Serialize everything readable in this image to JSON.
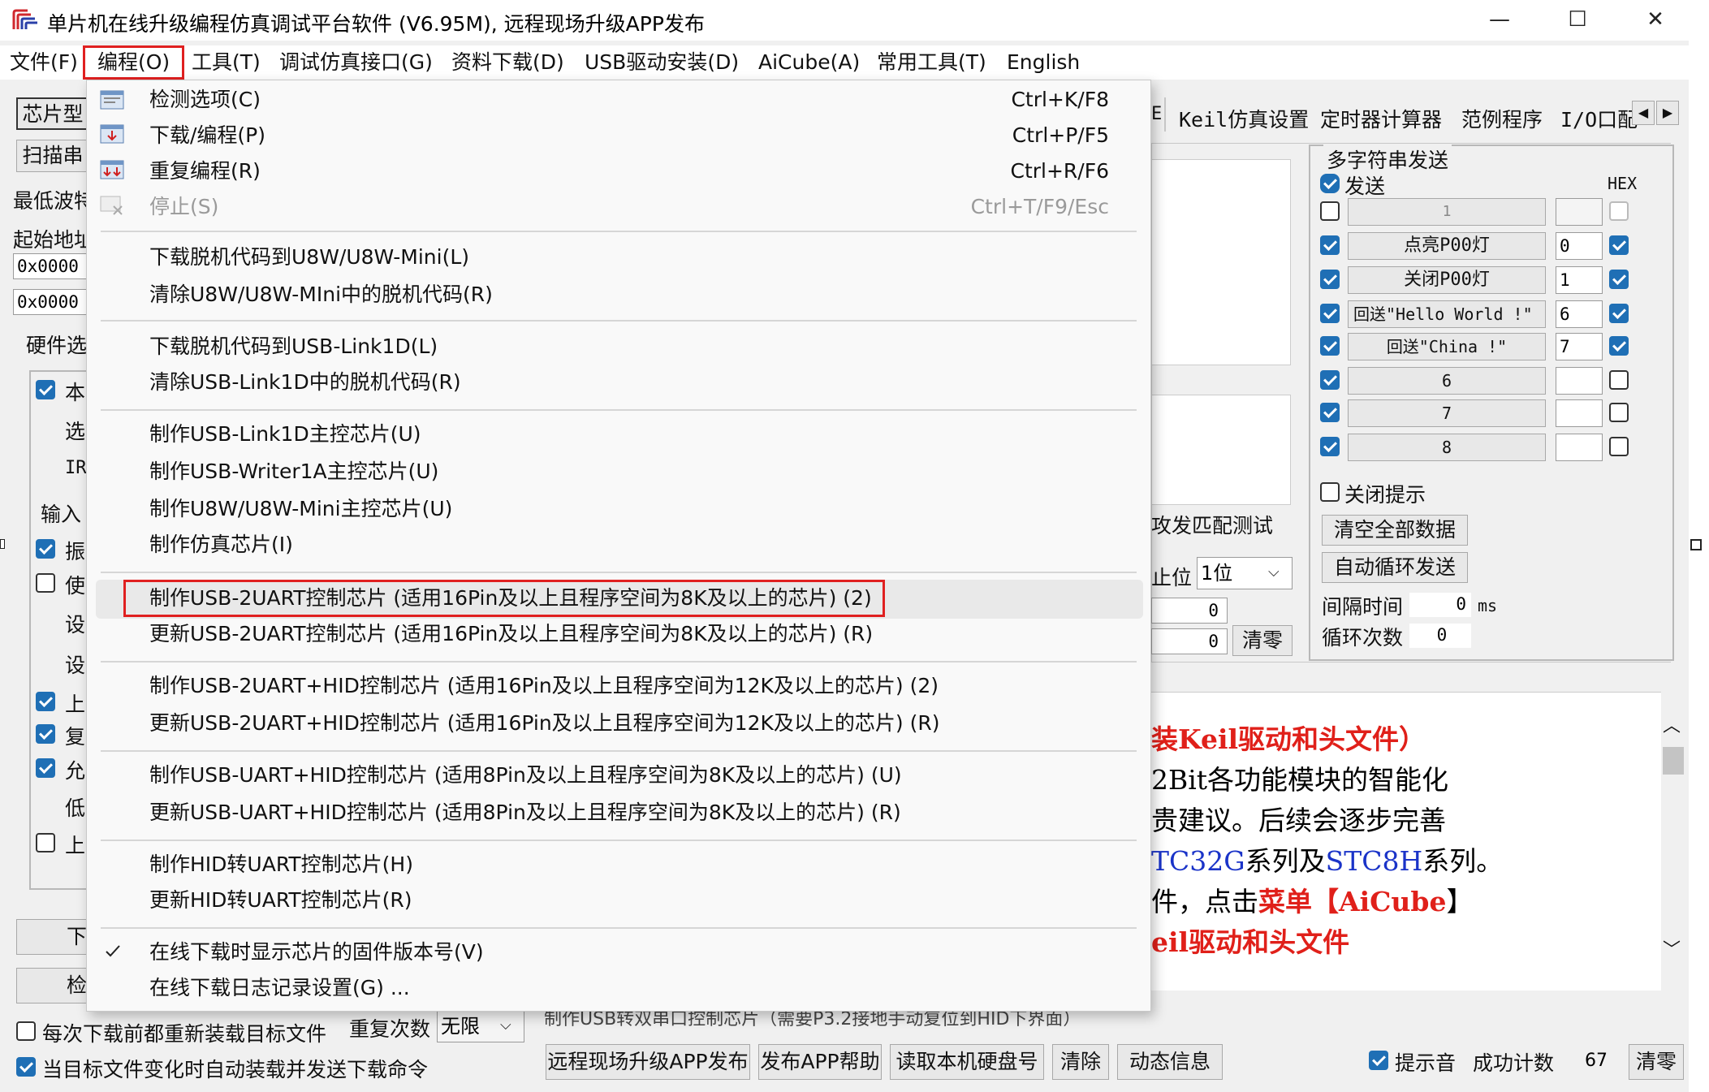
{
  "window": {
    "title": "单片机在线升级编程仿真调试平台软件 (V6.95M), 远程现场升级APP发布",
    "minimize": "—",
    "maximize": "☐",
    "close": "✕"
  },
  "menubar": [
    "文件(F)",
    "编程(O)",
    "工具(T)",
    "调试仿真接口(G)",
    "资料下载(D)",
    "USB驱动安装(D)",
    "AiCube(A)",
    "常用工具(T)",
    "English"
  ],
  "dropdown": {
    "items": [
      {
        "label": "检测选项(C)",
        "shortcut": "Ctrl+K/F8"
      },
      {
        "label": "下载/编程(P)",
        "shortcut": "Ctrl+P/F5"
      },
      {
        "label": "重复编程(R)",
        "shortcut": "Ctrl+R/F6"
      },
      {
        "label": "停止(S)",
        "shortcut": "Ctrl+T/F9/Esc"
      },
      {
        "label": "下载脱机代码到U8W/U8W-Mini(L)"
      },
      {
        "label": "清除U8W/U8W-MIni中的脱机代码(R)"
      },
      {
        "label": "下载脱机代码到USB-Link1D(L)"
      },
      {
        "label": "清除USB-Link1D中的脱机代码(R)"
      },
      {
        "label": "制作USB-Link1D主控芯片(U)"
      },
      {
        "label": "制作USB-Writer1A主控芯片(U)"
      },
      {
        "label": "制作U8W/U8W-Mini主控芯片(U)"
      },
      {
        "label": "制作仿真芯片(I)"
      },
      {
        "label": "制作USB-2UART控制芯片 (适用16Pin及以上且程序空间为8K及以上的芯片) (2)"
      },
      {
        "label": "更新USB-2UART控制芯片 (适用16Pin及以上且程序空间为8K及以上的芯片) (R)"
      },
      {
        "label": "制作USB-2UART+HID控制芯片 (适用16Pin及以上且程序空间为12K及以上的芯片) (2)"
      },
      {
        "label": "更新USB-2UART+HID控制芯片 (适用16Pin及以上且程序空间为12K及以上的芯片) (R)"
      },
      {
        "label": "制作USB-UART+HID控制芯片 (适用8Pin及以上且程序空间为8K及以上的芯片) (U)"
      },
      {
        "label": "更新USB-UART+HID控制芯片 (适用8Pin及以上且程序空间为8K及以上的芯片) (R)"
      },
      {
        "label": "制作HID转UART控制芯片(H)"
      },
      {
        "label": "更新HID转UART控制芯片(R)"
      },
      {
        "label": "在线下载时显示芯片的固件版本号(V)"
      },
      {
        "label": "在线下载日志记录设置(G) ..."
      }
    ]
  },
  "left": {
    "chip_btn": "芯片型",
    "scan_btn": "扫描串",
    "baud_label": "最低波特",
    "start_addr_label": "起始地址",
    "addr1": "0x0000",
    "addr2": "0x0000",
    "hw_tab": "硬件选",
    "opts": [
      "本",
      "选",
      "IR",
      "输入",
      "振",
      "使",
      "设",
      "设",
      "上",
      "复",
      "允",
      "低",
      "上"
    ],
    "download_btn": "下",
    "check_btn": "检"
  },
  "tabs": [
    "E",
    "Keil仿真设置",
    "定时器计算器",
    "范例程序",
    "I/O口配"
  ],
  "multi": {
    "title": "多字符串发送",
    "send_label": "发送",
    "hex_label": "HEX",
    "rows": [
      {
        "text": "1",
        "value": ""
      },
      {
        "text": "点亮P00灯",
        "value": "0"
      },
      {
        "text": "关闭P00灯",
        "value": "1"
      },
      {
        "text": "回送\"Hello World !\"",
        "value": "6"
      },
      {
        "text": "回送\"China !\"",
        "value": "7"
      },
      {
        "text": "6",
        "value": ""
      },
      {
        "text": "7",
        "value": ""
      },
      {
        "text": "8",
        "value": ""
      }
    ],
    "close_hint": "关闭提示",
    "clear_all": "清空全部数据",
    "auto_loop": "自动循环发送",
    "interval_label": "间隔时间",
    "interval_value": "0",
    "interval_unit": "ms",
    "loop_label": "循环次数",
    "loop_value": "0"
  },
  "mid": {
    "match_test": "攻发匹配测试",
    "stop_bits_label": "止位",
    "stop_bits_value": "1位",
    "count1": "0",
    "count2": "0",
    "clear_btn": "清零"
  },
  "log": {
    "line1": "装Keil驱动和头文件）",
    "line2": "2Bit各功能模块的智能化",
    "line3": "贵建议。后续会逐步完善",
    "line4a": "TC32G",
    "line4b": "系列及",
    "line4c": "STC8H",
    "line4d": "系列。",
    "line5a": "件，点击",
    "line5b": "菜单【",
    "line5c": "AiCube",
    "line5d": "】",
    "line6": "eil驱动和头文件"
  },
  "bottom": {
    "reload_label": "每次下载前都重新装载目标文件",
    "auto_label": "当目标文件变化时自动装载并发送下载命令",
    "repeat_label": "重复次数",
    "repeat_value": "无限",
    "status_text": "制作USB转双串口控制芯片（需要P3.2接地手动复位到HID下界面）",
    "remote_btn": "远程现场升级APP发布",
    "help_btn": "发布APP帮助",
    "disk_btn": "读取本机硬盘号",
    "clear_btn": "清除",
    "dyn_btn": "动态信息",
    "sound_label": "提示音",
    "success_label": "成功计数",
    "success_value": "67",
    "zero_btn": "清零"
  }
}
